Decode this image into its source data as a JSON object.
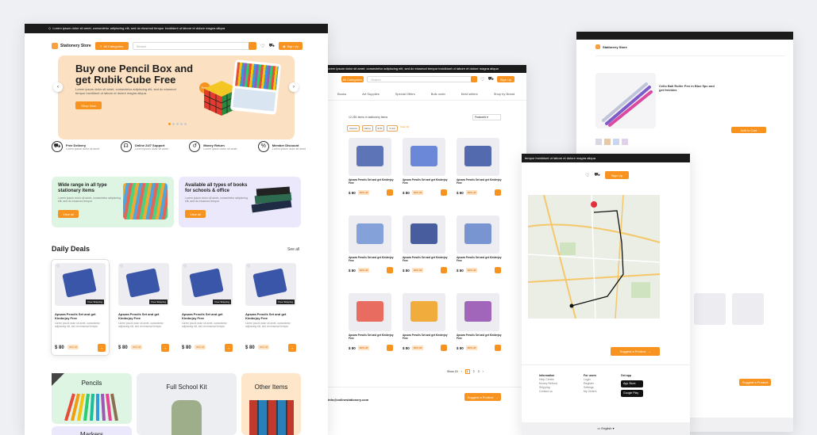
{
  "topbar_text": "Lorem ipsum dolor sit amet, consectetur adipiscing elit, sed do eiusmod tempor incididunt ut labore et dolore magna aliqua",
  "brand": {
    "name": "Stationery Store"
  },
  "header": {
    "category_button": "All Categories",
    "search_placeholder": "Search",
    "signup": "Sign Up"
  },
  "hero": {
    "title": "Buy one Pencil Box and get Rubik Cube Free",
    "text": "Lorem ipsum dolor sit amet, consectetur adipiscing elit, sed do eiusmod tempor incididunt ut labore et dolore magna aliqua.",
    "button": "Shop Now",
    "badge": "Free"
  },
  "features": [
    {
      "icon": "truck-icon",
      "title": "Free Delivery",
      "sub": "Lorem ipsum dolor sit amet"
    },
    {
      "icon": "headset-icon",
      "title": "Online 24/7 Support",
      "sub": "Lorem ipsum dolor sit amet"
    },
    {
      "icon": "money-return-icon",
      "title": "Money Return",
      "sub": "Lorem ipsum dolor sit amet"
    },
    {
      "icon": "discount-icon",
      "title": "Member Discount",
      "sub": "Lorem ipsum dolor sit amet"
    }
  ],
  "promos": [
    {
      "title": "Wide range in all type stationary items",
      "text": "Lorem ipsum dolor sit amet, consectetur adipiscing elit, sed do eiusmod tempor",
      "button": "View all",
      "color": "#dff5e4"
    },
    {
      "title": "Available all types of books for schools & office",
      "text": "Lorem ipsum dolor sit amet, consectetur adipiscing elit, sed do eiusmod tempor",
      "button": "View all",
      "color": "#ece8fb"
    }
  ],
  "daily_deals": {
    "title": "Daily Deals",
    "see_all": "See all",
    "products": [
      {
        "title": "Apsara Pencils Set and get Kinderjoy Free",
        "desc": "Lorem ipsum dolor sit amet, consectetur adipiscing elit, sed do eiusmod tempor",
        "price": "$ 80",
        "off": "30% off",
        "tag": "Free Shipping"
      },
      {
        "title": "Apsara Pencils Set and get Kinderjoy Free",
        "desc": "Lorem ipsum dolor sit amet, consectetur adipiscing elit, sed do eiusmod tempor",
        "price": "$ 80",
        "off": "30% off",
        "tag": "Free Shipping"
      },
      {
        "title": "Apsara Pencils Set and get Kinderjoy Free",
        "desc": "Lorem ipsum dolor sit amet, consectetur adipiscing elit, sed do eiusmod tempor",
        "price": "$ 80",
        "off": "30% off",
        "tag": "Free Shipping"
      },
      {
        "title": "Apsara Pencils Set and get Kinderjoy Free",
        "desc": "Lorem ipsum dolor sit amet, consectetur adipiscing elit, sed do eiusmod tempor",
        "price": "$ 80",
        "off": "30% off",
        "tag": "Free Shipping"
      }
    ]
  },
  "categories": [
    {
      "name": "Pencils",
      "color": "#dff5e4"
    },
    {
      "name": "Full School Kit",
      "color": "#eceef2"
    },
    {
      "name": "Other Items",
      "color": "#fde6c9"
    },
    {
      "name": "Markers",
      "color": "#ece8fb"
    }
  ],
  "listing": {
    "nav": [
      "Books",
      "Art Supplies",
      "Special Offers",
      "Bulk order",
      "Best sellers",
      "Shop by Brand"
    ],
    "results": "12,281 items in stationery items",
    "sort": "Featured",
    "filters": [
      "Apsara",
      "Natraj",
      "$ 80",
      "5 star"
    ],
    "clear": "Clear All",
    "product_title": "Apsara Pencils Set and get Kinderjoy Free",
    "price": "$ 80",
    "off": "30% off",
    "pagination": [
      "1",
      "2",
      "3"
    ],
    "show": "Show 15",
    "footer_email": "info@onlinestationery.com",
    "suggest": "Suggest a Product"
  },
  "map_view": {
    "topbar_text": "tempor incididunt ut labore et dolore magna aliqua",
    "signup": "Sign Up",
    "suggest": "Suggest a Product",
    "footer": {
      "info": {
        "title": "Information",
        "items": [
          "Help Centre",
          "Money Refund",
          "Shipping",
          "Contact us"
        ]
      },
      "users": {
        "title": "For users",
        "items": [
          "Login",
          "Register",
          "Settings",
          "My Orders"
        ]
      },
      "app": {
        "title": "Get app",
        "stores": [
          "App Store",
          "Google Play"
        ]
      }
    },
    "language": "English"
  },
  "detail_view": {
    "title": "Cello Ball Roller Pen in Blue 5pc and get freebies",
    "buy_button": "Add to Cart"
  }
}
